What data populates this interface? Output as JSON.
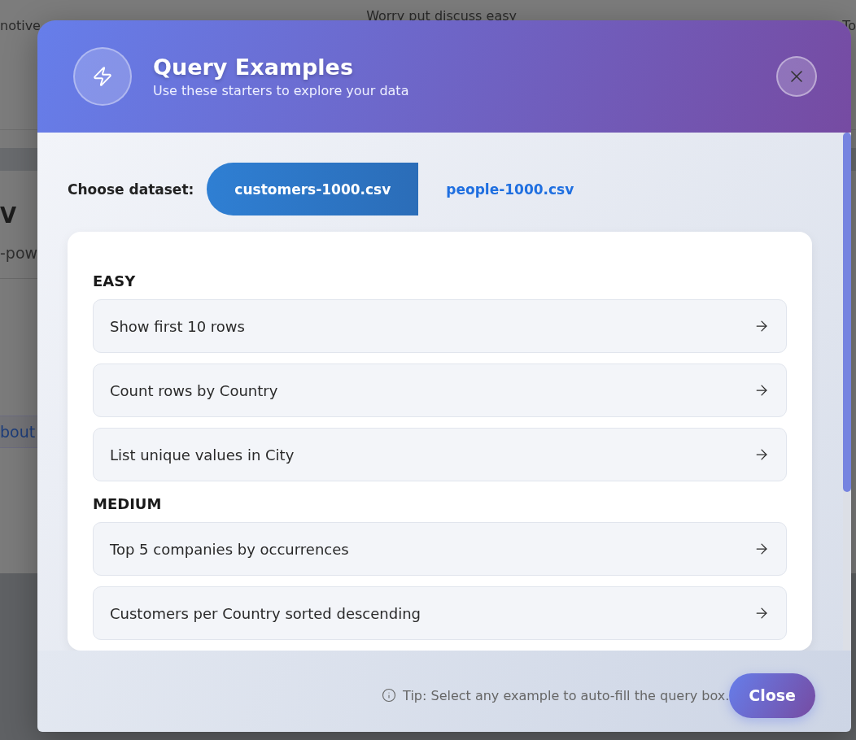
{
  "background": {
    "top_row": [
      "notive",
      "Worry put discuss easy",
      "To"
    ],
    "heading": "V",
    "subtitle": "-pow",
    "link": "bout"
  },
  "modal": {
    "title": "Query Examples",
    "subtitle": "Use these starters to explore your data",
    "dataset_label": "Choose dataset:",
    "datasets": [
      {
        "label": "customers-1000.csv",
        "selected": true
      },
      {
        "label": "people-1000.csv",
        "selected": false
      }
    ],
    "sections": [
      {
        "heading": "EASY",
        "examples": [
          "Show first 10 rows",
          "Count rows by Country",
          "List unique values in City"
        ]
      },
      {
        "heading": "MEDIUM",
        "examples": [
          "Top 5 companies by occurrences",
          "Customers per Country sorted descending"
        ]
      }
    ],
    "tip": "Tip: Select any example to auto-fill the query box.",
    "close_button": "Close"
  }
}
